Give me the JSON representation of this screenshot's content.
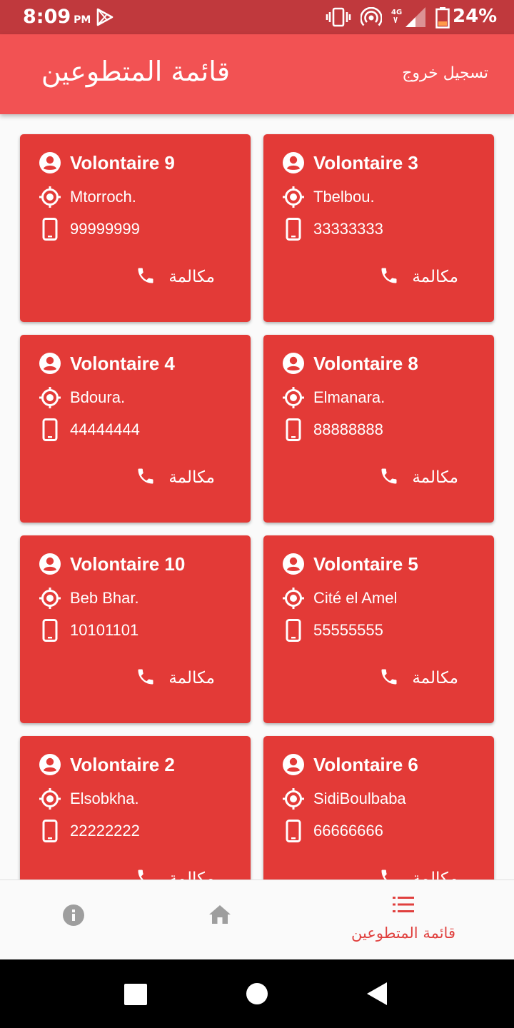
{
  "status": {
    "time": "8:09",
    "ampm": "PM",
    "network": "4G",
    "battery_pct": "24%"
  },
  "app_bar": {
    "title": "قائمة المتطوعين",
    "logout_label": "تسجيل خروج"
  },
  "volunteers": [
    {
      "name": "Volontaire 9",
      "location": "Mtorroch.",
      "phone": "99999999",
      "call_label": "مكالمة"
    },
    {
      "name": "Volontaire 3",
      "location": "Tbelbou.",
      "phone": "33333333",
      "call_label": "مكالمة"
    },
    {
      "name": "Volontaire 4",
      "location": "Bdoura.",
      "phone": "44444444",
      "call_label": "مكالمة"
    },
    {
      "name": "Volontaire 8",
      "location": "Elmanara.",
      "phone": "88888888",
      "call_label": "مكالمة"
    },
    {
      "name": "Volontaire 10",
      "location": "Beb Bhar.",
      "phone": "10101101",
      "call_label": "مكالمة"
    },
    {
      "name": "Volontaire 5",
      "location": "Cité el Amel",
      "phone": "55555555",
      "call_label": "مكالمة"
    },
    {
      "name": "Volontaire 2",
      "location": "Elsobkha.",
      "phone": "22222222",
      "call_label": "مكالمة"
    },
    {
      "name": "Volontaire 6",
      "location": "SidiBoulbaba",
      "phone": "66666666",
      "call_label": "مكالمة"
    }
  ],
  "bottom_nav": {
    "items": [
      {
        "icon": "info-icon",
        "label": ""
      },
      {
        "icon": "home-icon",
        "label": ""
      },
      {
        "icon": "list-icon",
        "label": "قائمة المتطوعين",
        "active": true
      }
    ]
  },
  "colors": {
    "status_bar": "#c0393d",
    "app_bar": "#f25253",
    "card": "#e33a37",
    "nav_active": "#e0403e",
    "nav_inactive": "#9e9e9e"
  }
}
